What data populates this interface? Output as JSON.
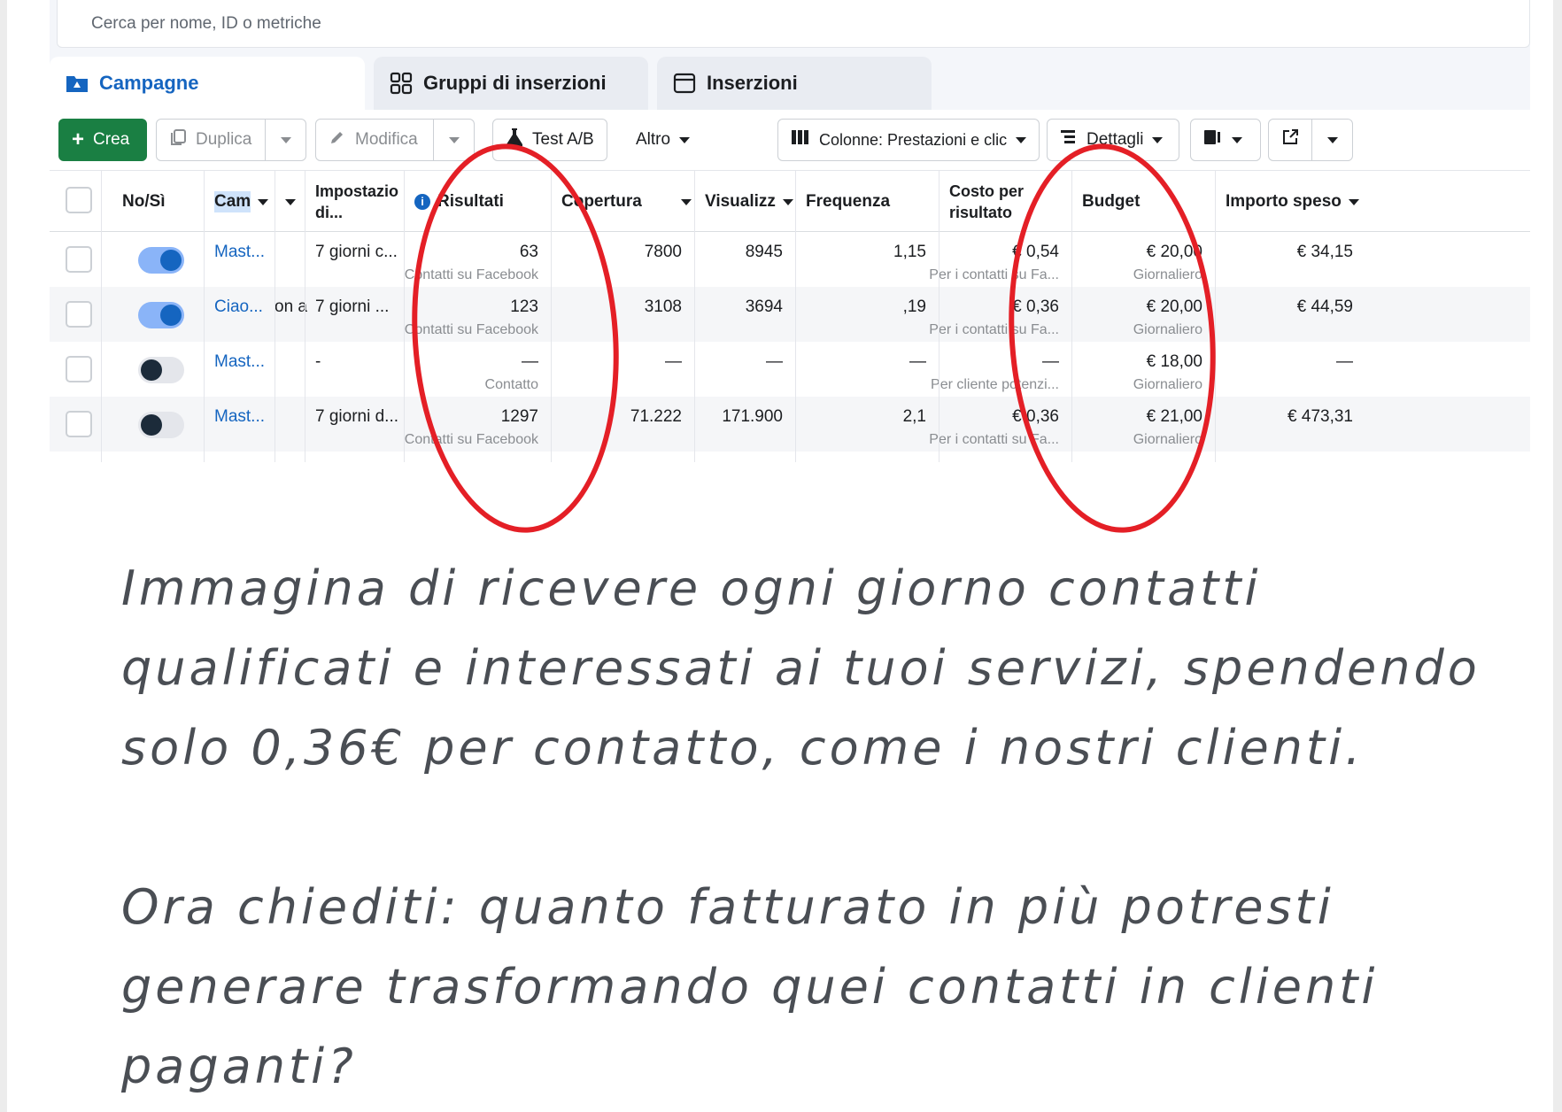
{
  "search": {
    "placeholder": "Cerca per nome, ID o metriche"
  },
  "tabs": [
    {
      "label": "Campagne",
      "icon": "folder-icon",
      "active": true
    },
    {
      "label": "Gruppi di inserzioni",
      "icon": "grid-icon",
      "active": false
    },
    {
      "label": "Inserzioni",
      "icon": "ad-frame-icon",
      "active": false
    }
  ],
  "toolbar": {
    "create": "Crea",
    "duplicate": "Duplica",
    "edit": "Modifica",
    "ab_test": "Test A/B",
    "more": "Altro",
    "columns": "Colonne: Prestazioni e clic",
    "breakdown": "Dettagli"
  },
  "table": {
    "headers": {
      "toggle": "No/Sì",
      "campaign": "Cam",
      "settings": "Impostazio di...",
      "results": "Risultati",
      "reach": "Copertura",
      "views": "Visualizz",
      "frequency": "Frequenza",
      "cost_per_result": "Costo per risultato",
      "budget": "Budget",
      "spent": "Importo speso"
    },
    "rows": [
      {
        "on": true,
        "name": "Mast...",
        "extra": "",
        "settings": "7 giorni c...",
        "results": "63",
        "results_sub": "Contatti su Facebook",
        "reach": "7800",
        "views": "8945",
        "frequency": "1,15",
        "cpr": "€ 0,54",
        "cpr_sub": "Per i contatti su Fa...",
        "budget": "€ 20,00",
        "budget_sub": "Giornaliero",
        "spent": "€ 34,15"
      },
      {
        "on": true,
        "name": "Ciao...",
        "extra": "on a",
        "settings": "7 giorni ...",
        "results": "123",
        "results_sub": "Contatti su Facebook",
        "reach": "3108",
        "views": "3694",
        "frequency": ",19",
        "cpr": "€ 0,36",
        "cpr_sub": "Per i contatti su Fa...",
        "budget": "€ 20,00",
        "budget_sub": "Giornaliero",
        "spent": "€ 44,59"
      },
      {
        "on": false,
        "name": "Mast...",
        "extra": "",
        "settings": "-",
        "results": "—",
        "results_sub": "Contatto",
        "reach": "—",
        "views": "—",
        "frequency": "—",
        "cpr": "—",
        "cpr_sub": "Per cliente potenzi...",
        "budget": "€ 18,00",
        "budget_sub": "Giornaliero",
        "spent": "—"
      },
      {
        "on": false,
        "name": "Mast...",
        "extra": "",
        "settings": "7 giorni d...",
        "results": "1297",
        "results_sub": "Contatti su Facebook",
        "reach": "71.222",
        "views": "171.900",
        "frequency": "2,1",
        "cpr": "€ 0,36",
        "cpr_sub": "Per i contatti su Fa...",
        "budget": "€ 21,00",
        "budget_sub": "Giornaliero",
        "spent": "€ 473,31"
      }
    ]
  },
  "colors": {
    "accent": "#1565c0",
    "create": "#1a7f43",
    "annotation": "#e41f26"
  },
  "quote": {
    "line1": "Immagina di ricevere ogni giorno contatti",
    "line2": "qualificati e interessati ai tuoi servizi, spendendo",
    "line3": "solo 0,36€ per contatto, come i nostri clienti.",
    "line4": "Ora chiediti: quanto fatturato in più potresti",
    "line5": "generare trasformando quei contatti in clienti",
    "line6": "paganti?"
  }
}
